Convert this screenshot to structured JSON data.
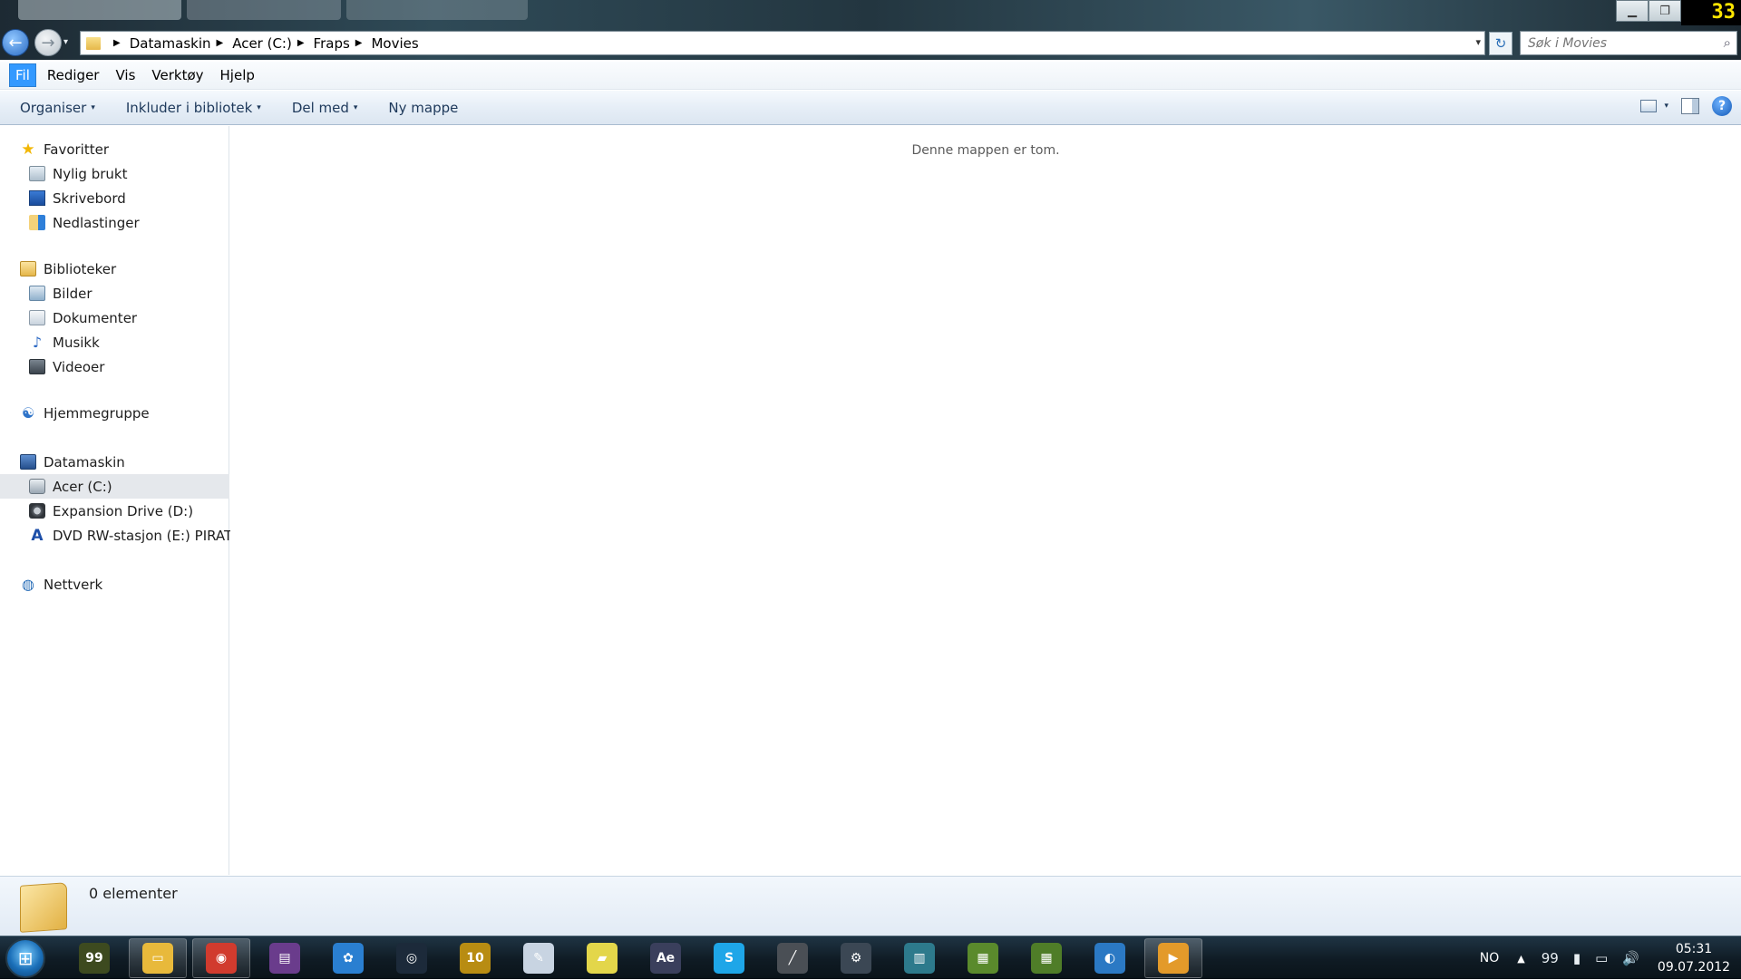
{
  "window": {
    "controls": {
      "minimize": "▁",
      "maximize": "❐",
      "close_hint": ""
    },
    "fraps_counter": "33"
  },
  "nav": {
    "back_glyph": "←",
    "forward_glyph": "→",
    "dropdown_glyph": "▾",
    "breadcrumbs": [
      "Datamaskin",
      "Acer (C:)",
      "Fraps",
      "Movies"
    ],
    "crumb_separator": "▶",
    "address_dropdown": "▾",
    "refresh_glyph": "↻",
    "search_placeholder": "Søk i Movies",
    "search_glyph": "⌕"
  },
  "menubar": {
    "items": [
      "Fil",
      "Rediger",
      "Vis",
      "Verktøy",
      "Hjelp"
    ]
  },
  "commandbar": {
    "organize": "Organiser",
    "include": "Inkluder i bibliotek",
    "share": "Del med",
    "new_folder": "Ny mappe",
    "caret": "▾",
    "help_glyph": "?"
  },
  "sidebar": {
    "favorites": {
      "label": "Favoritter",
      "items": [
        "Nylig brukt",
        "Skrivebord",
        "Nedlastinger"
      ]
    },
    "libraries": {
      "label": "Biblioteker",
      "items": [
        "Bilder",
        "Dokumenter",
        "Musikk",
        "Videoer"
      ]
    },
    "homegroup": {
      "label": "Hjemmegruppe"
    },
    "computer": {
      "label": "Datamaskin",
      "items": [
        "Acer (C:)",
        "Expansion Drive (D:)",
        "DVD RW-stasjon (E:) PIRATES"
      ],
      "selected": "Acer (C:)"
    },
    "network": {
      "label": "Nettverk"
    },
    "icons": {
      "star": "★",
      "music": "♪",
      "homegroup": "☯",
      "dvd": "A",
      "network": "◍"
    }
  },
  "content": {
    "empty_message": "Denne mappen er tom."
  },
  "details": {
    "item_count": "0 elementer"
  },
  "taskbar": {
    "start_glyph": "⊞",
    "apps": [
      {
        "name": "fraps",
        "label": "99",
        "color": "#3d4a1f"
      },
      {
        "name": "explorer",
        "label": "▭",
        "color": "#e8b93b",
        "open": true
      },
      {
        "name": "chrome",
        "label": "◉",
        "color": "#d13b2e",
        "open": true
      },
      {
        "name": "winrar",
        "label": "▤",
        "color": "#6a3c8c"
      },
      {
        "name": "hub",
        "label": "✿",
        "color": "#2a7fd1"
      },
      {
        "name": "media-player",
        "label": "◎",
        "color": "#1c2a3a"
      },
      {
        "name": "game-10",
        "label": "10",
        "color": "#b88c12"
      },
      {
        "name": "paint",
        "label": "✎",
        "color": "#c8d4e2"
      },
      {
        "name": "sticky-notes",
        "label": "▰",
        "color": "#e3d64a"
      },
      {
        "name": "after-effects",
        "label": "Ae",
        "color": "#3a3f5c"
      },
      {
        "name": "skype",
        "label": "S",
        "color": "#1ea6e8"
      },
      {
        "name": "pen-tool",
        "label": "╱",
        "color": "#4a4f55"
      },
      {
        "name": "steam",
        "label": "⚙",
        "color": "#3b4754"
      },
      {
        "name": "app-window",
        "label": "▥",
        "color": "#2d7a8c"
      },
      {
        "name": "minecraft-1",
        "label": "▦",
        "color": "#5a8a2c"
      },
      {
        "name": "minecraft-2",
        "label": "▦",
        "color": "#4f7d28"
      },
      {
        "name": "browser-blue",
        "label": "◐",
        "color": "#2b79c4"
      },
      {
        "name": "recorder",
        "label": "▶",
        "color": "#e39a2a",
        "open": true
      }
    ],
    "tray": {
      "language": "NO",
      "chevron": "▲",
      "icons": [
        "99",
        "▮",
        "▭",
        "🔊"
      ],
      "time": "05:31",
      "date": "09.07.2012"
    }
  }
}
